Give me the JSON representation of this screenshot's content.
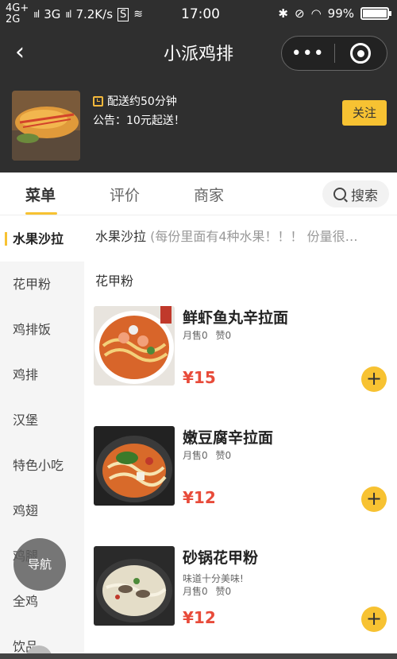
{
  "status_bar": {
    "signal_top": "4G+",
    "signal_bottom": "2G",
    "network_3g": "3G",
    "speed": "7.2K/s",
    "time": "17:00",
    "battery_text": "99%",
    "battery_level": 0.99
  },
  "nav": {
    "title": "小派鸡排",
    "more_glyph": "•••"
  },
  "shop": {
    "delivery": "配送约50分钟",
    "notice": "公告：10元起送！",
    "follow_label": "关注"
  },
  "tabs": {
    "menu": "菜单",
    "reviews": "评价",
    "merchant": "商家",
    "search": "搜索"
  },
  "sidebar": {
    "items": [
      {
        "label": "水果沙拉"
      },
      {
        "label": "花甲粉"
      },
      {
        "label": "鸡排饭"
      },
      {
        "label": "鸡排"
      },
      {
        "label": "汉堡"
      },
      {
        "label": "特色小吃"
      },
      {
        "label": "鸡翅"
      },
      {
        "label": "鸡腿"
      },
      {
        "label": "全鸡"
      },
      {
        "label": "饮品"
      }
    ],
    "nav_button": "导航"
  },
  "main": {
    "category1_title": "水果沙拉",
    "category1_desc": "(每份里面有4种水果！！！ 份量很…",
    "category2_title": "花甲粉",
    "products": [
      {
        "name": "鲜虾鱼丸辛拉面",
        "desc": "",
        "sales": "月售0",
        "likes": "赞0",
        "price": "¥15"
      },
      {
        "name": "嫩豆腐辛拉面",
        "desc": "",
        "sales": "月售0",
        "likes": "赞0",
        "price": "¥12"
      },
      {
        "name": "砂锅花甲粉",
        "desc": "味道十分美味!",
        "sales": "月售0",
        "likes": "赞0",
        "price": "¥12"
      }
    ],
    "add_glyph": "+"
  },
  "colors": {
    "accent": "#f7c232",
    "price": "#e84b3a",
    "header_bg": "#2f2f2f"
  }
}
